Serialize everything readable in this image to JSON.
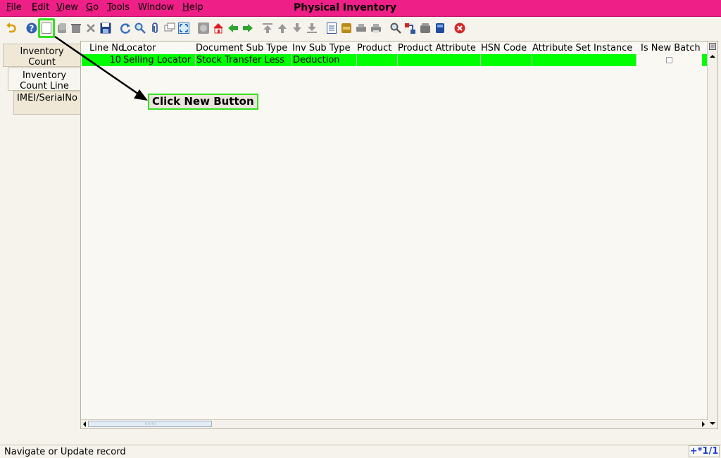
{
  "menubar": {
    "items": [
      "File",
      "Edit",
      "View",
      "Go",
      "Tools",
      "Window",
      "Help"
    ],
    "mnemonics": [
      "F",
      "E",
      "V",
      "G",
      "T",
      "W",
      "H"
    ]
  },
  "window": {
    "title": "Physical Inventory"
  },
  "colors": {
    "titlebar": "#ee1f86",
    "row_highlight": "#00ff00",
    "annotation": "#34e21f"
  },
  "toolbar": {
    "icons": [
      "undo-icon",
      "help-icon",
      "new-record-icon",
      "copy-record-icon",
      "delete-icon",
      "delete-selection-icon",
      "save-icon",
      "refresh-icon",
      "find-icon",
      "attachment-icon",
      "chat-icon",
      "grid-toggle-icon",
      "history-icon",
      "home-icon",
      "back-icon",
      "forward-icon",
      "first-record-icon",
      "previous-record-icon",
      "next-record-icon",
      "last-record-icon",
      "report-icon",
      "archive-icon",
      "print-preview-icon",
      "print-icon",
      "zoom-across-icon",
      "request-icon",
      "product-info-icon",
      "process-icon",
      "exit-icon"
    ]
  },
  "tabs": [
    {
      "label_line1": "Inventory",
      "label_line2": "Count",
      "active": false
    },
    {
      "label_line1": "Inventory",
      "label_line2": "Count Line",
      "active": true
    },
    {
      "label_line1": "IMEI/SerialNo",
      "label_line2": "",
      "active": false
    }
  ],
  "grid": {
    "columns": [
      "Line No",
      "Locator",
      "Document Sub Type",
      "Inv Sub Type",
      "Product",
      "Product Attribute",
      "HSN Code",
      "Attribute Set Instance",
      "Is New Batch"
    ],
    "rows": [
      {
        "line_no": "10",
        "locator": "Selling Locator",
        "document_sub_type": "Stock Transfer Less",
        "inv_sub_type": "Deduction",
        "product": "",
        "product_attribute": "",
        "hsn_code": "",
        "attribute_set_instance": "",
        "is_new_batch": false
      }
    ]
  },
  "annotation": {
    "label": "Click New Button"
  },
  "status": {
    "text": "Navigate or Update record",
    "record_count": "+*1/1"
  }
}
